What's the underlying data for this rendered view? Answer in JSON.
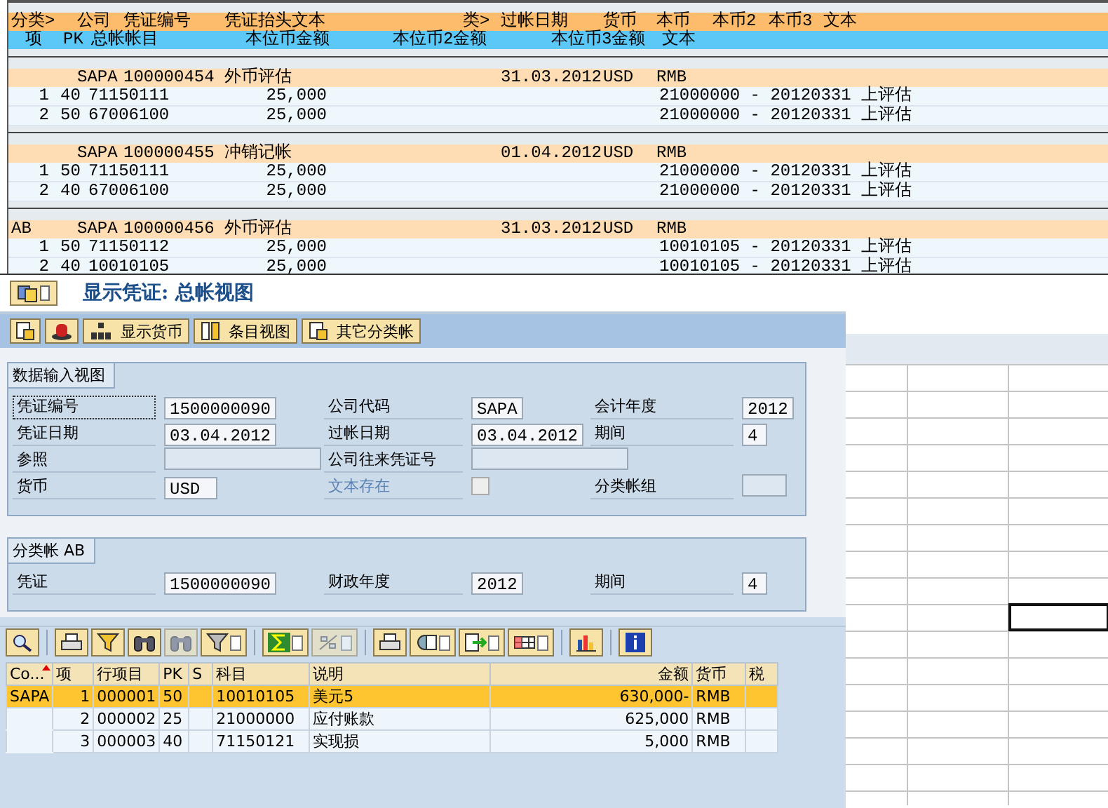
{
  "report": {
    "header_row": [
      "分类>",
      "公司",
      "凭证编号",
      "凭证抬头文本",
      "类>",
      "过帐日期",
      "货币",
      "本币",
      "本币2",
      "本币3",
      "文本"
    ],
    "subheader_row": [
      "项",
      "PK",
      "总帐帐目",
      "本位币金额",
      "本位币2金额",
      "本位币3金额",
      "文本"
    ],
    "documents": [
      {
        "company": "SAPA",
        "doc_no": "100000454",
        "header_text": "外币评估",
        "posting_date": "31.03.2012",
        "currency": "USD",
        "local_currency": "RMB",
        "items": [
          {
            "item": "1",
            "pk": "40",
            "account": "71150111",
            "amount": "25,000",
            "text": "21000000 - 20120331 上评估"
          },
          {
            "item": "2",
            "pk": "50",
            "account": "67006100",
            "amount": "25,000",
            "text": "21000000 - 20120331 上评估"
          }
        ]
      },
      {
        "company": "SAPA",
        "doc_no": "100000455",
        "header_text": "冲销记帐",
        "posting_date": "01.04.2012",
        "currency": "USD",
        "local_currency": "RMB",
        "items": [
          {
            "item": "1",
            "pk": "50",
            "account": "71150111",
            "amount": "25,000",
            "text": "21000000 - 20120331 上评估"
          },
          {
            "item": "2",
            "pk": "40",
            "account": "67006100",
            "amount": "25,000",
            "text": "21000000 - 20120331 上评估"
          }
        ]
      },
      {
        "ledger": "AB",
        "company": "SAPA",
        "doc_no": "100000456",
        "header_text": "外币评估",
        "posting_date": "31.03.2012",
        "currency": "USD",
        "local_currency": "RMB",
        "items": [
          {
            "item": "1",
            "pk": "50",
            "account": "71150112",
            "amount": "25,000",
            "text": "10010105 - 20120331 上评估"
          },
          {
            "item": "2",
            "pk": "40",
            "account": "10010105",
            "amount": "25,000",
            "text": "10010105 - 20120331 上评估"
          }
        ]
      }
    ]
  },
  "window": {
    "title": "显示凭证: 总帐视图"
  },
  "app_toolbar": [
    "显示货币",
    "条目视图",
    "其它分类帐"
  ],
  "data_entry": {
    "title": "数据输入视图",
    "rows": [
      [
        {
          "label": "凭证编号",
          "value": "1500000090"
        },
        {
          "label": "公司代码",
          "value": "SAPA"
        },
        {
          "label": "会计年度",
          "value": "2012"
        }
      ],
      [
        {
          "label": "凭证日期",
          "value": "03.04.2012"
        },
        {
          "label": "过帐日期",
          "value": "03.04.2012"
        },
        {
          "label": "期间",
          "value": "4"
        }
      ],
      [
        {
          "label": "参照"
        },
        {
          "label": "公司往来凭证号"
        }
      ],
      [
        {
          "label": "货币",
          "value": "USD"
        },
        {
          "label": "文本存在",
          "kind": "checkbox",
          "checked": false,
          "disabled": true
        },
        {
          "label": "分类帐组"
        }
      ]
    ]
  },
  "ledger_panel": {
    "title": "分类帐 AB",
    "rows": [
      [
        {
          "label": "凭证",
          "value": "1500000090"
        },
        {
          "label": "财政年度",
          "value": "2012"
        },
        {
          "label": "期间",
          "value": "4"
        }
      ]
    ]
  },
  "alv_toolbar": [
    [
      {
        "kind": "details",
        "disabled": false
      }
    ],
    [
      {
        "kind": "print",
        "disabled": false
      },
      {
        "kind": "sort",
        "disabled": false
      },
      {
        "kind": "find",
        "disabled": false
      },
      {
        "kind": "find_next",
        "disabled": true
      },
      {
        "kind": "filter",
        "disabled": false
      }
    ],
    [
      {
        "kind": "sum",
        "disabled": false
      },
      {
        "kind": "subtotal",
        "disabled": true
      }
    ],
    [
      {
        "kind": "preview",
        "disabled": false
      },
      {
        "kind": "views",
        "disabled": false
      },
      {
        "kind": "export",
        "disabled": false
      },
      {
        "kind": "layout",
        "disabled": false
      }
    ],
    [
      {
        "kind": "chart",
        "disabled": false
      }
    ],
    [
      {
        "kind": "info",
        "disabled": false
      }
    ]
  ],
  "table": {
    "columns": [
      "Co...",
      "项",
      "行项目",
      "PK",
      "S",
      "科目",
      "说明",
      "金额",
      "货币",
      "税"
    ],
    "rows": [
      {
        "selected": true,
        "cells": [
          "SAPA",
          "1",
          "000001",
          "50",
          "",
          "10010105",
          "美元5",
          "630,000-",
          "RMB",
          ""
        ]
      },
      {
        "selected": false,
        "cells": [
          "",
          "2",
          "000002",
          "25",
          "",
          "21000000",
          "应付账款",
          "625,000",
          "RMB",
          ""
        ]
      },
      {
        "selected": false,
        "cells": [
          "",
          "3",
          "000003",
          "40",
          "",
          "71150121",
          "实现损",
          "5,000",
          "RMB",
          ""
        ]
      }
    ]
  }
}
